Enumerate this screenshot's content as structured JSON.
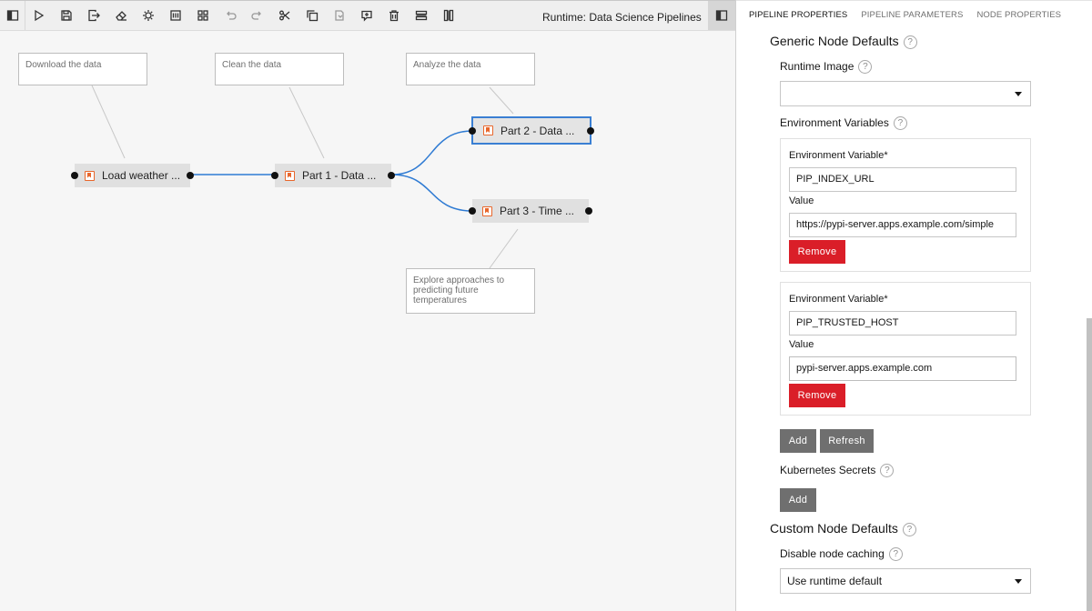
{
  "toolbar": {
    "runtime_label": "Runtime: Data Science Pipelines",
    "buttons": [
      "toggle-palette",
      "run",
      "save",
      "export",
      "clear",
      "open-runtimes",
      "open-component-catalogs",
      "auto-arrange",
      "undo",
      "redo",
      "cut",
      "copy",
      "paste",
      "add-comment",
      "delete",
      "arrange-horizontally",
      "arrange-vertically"
    ]
  },
  "canvas": {
    "comments": [
      {
        "id": "c1",
        "text": "Download the data"
      },
      {
        "id": "c2",
        "text": "Clean the data"
      },
      {
        "id": "c3",
        "text": "Analyze the data"
      },
      {
        "id": "c4",
        "text": "Explore approaches to predicting future temperatures"
      }
    ],
    "nodes": [
      {
        "id": "n1",
        "label": "Load weather ...",
        "selected": false
      },
      {
        "id": "n2",
        "label": "Part 1 - Data ...",
        "selected": false
      },
      {
        "id": "n3",
        "label": "Part 2 - Data ...",
        "selected": true
      },
      {
        "id": "n4",
        "label": "Part 3 - Time ...",
        "selected": false
      }
    ],
    "colors": {
      "link": "#2f7bd3",
      "comment_link": "#c8c8c8",
      "node_icon": "#e8662b"
    }
  },
  "panel": {
    "tabs": [
      "PIPELINE PROPERTIES",
      "PIPELINE PARAMETERS",
      "NODE PROPERTIES"
    ],
    "active_tab": "PIPELINE PROPERTIES",
    "generic_defaults_title": "Generic Node Defaults",
    "runtime_image_label": "Runtime Image",
    "runtime_image_value": "",
    "env_vars_label": "Environment Variables",
    "env_vars": [
      {
        "name_label": "Environment Variable*",
        "name": "PIP_INDEX_URL",
        "value_label": "Value",
        "value": "https://pypi-server.apps.example.com/simple",
        "remove_label": "Remove"
      },
      {
        "name_label": "Environment Variable*",
        "name": "PIP_TRUSTED_HOST",
        "value_label": "Value",
        "value": "pypi-server.apps.example.com",
        "remove_label": "Remove"
      }
    ],
    "add_label": "Add",
    "refresh_label": "Refresh",
    "k8s_secrets_label": "Kubernetes Secrets",
    "k8s_add_label": "Add",
    "custom_defaults_title": "Custom Node Defaults",
    "disable_caching_label": "Disable node caching",
    "disable_caching_value": "Use runtime default",
    "help_glyph": "?",
    "colors": {
      "remove": "#da1e28",
      "secondary_button": "#6f6f6f"
    }
  }
}
